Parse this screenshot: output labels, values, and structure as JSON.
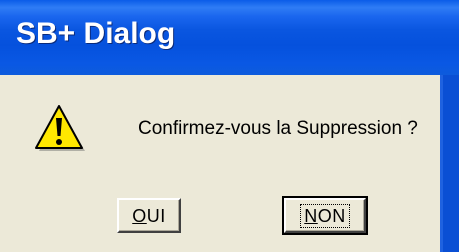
{
  "window": {
    "title": "SB+ Dialog"
  },
  "dialog": {
    "icon": "warning-icon",
    "message": "Confirmez-vous la Suppression ?"
  },
  "buttons": {
    "yes": {
      "mnemonic": "O",
      "rest": "UI"
    },
    "no": {
      "mnemonic": "N",
      "rest": "ON"
    }
  },
  "colors": {
    "titlebar": "#0551dd",
    "client_bg": "#ece9d8",
    "warning_yellow": "#ffe800"
  }
}
